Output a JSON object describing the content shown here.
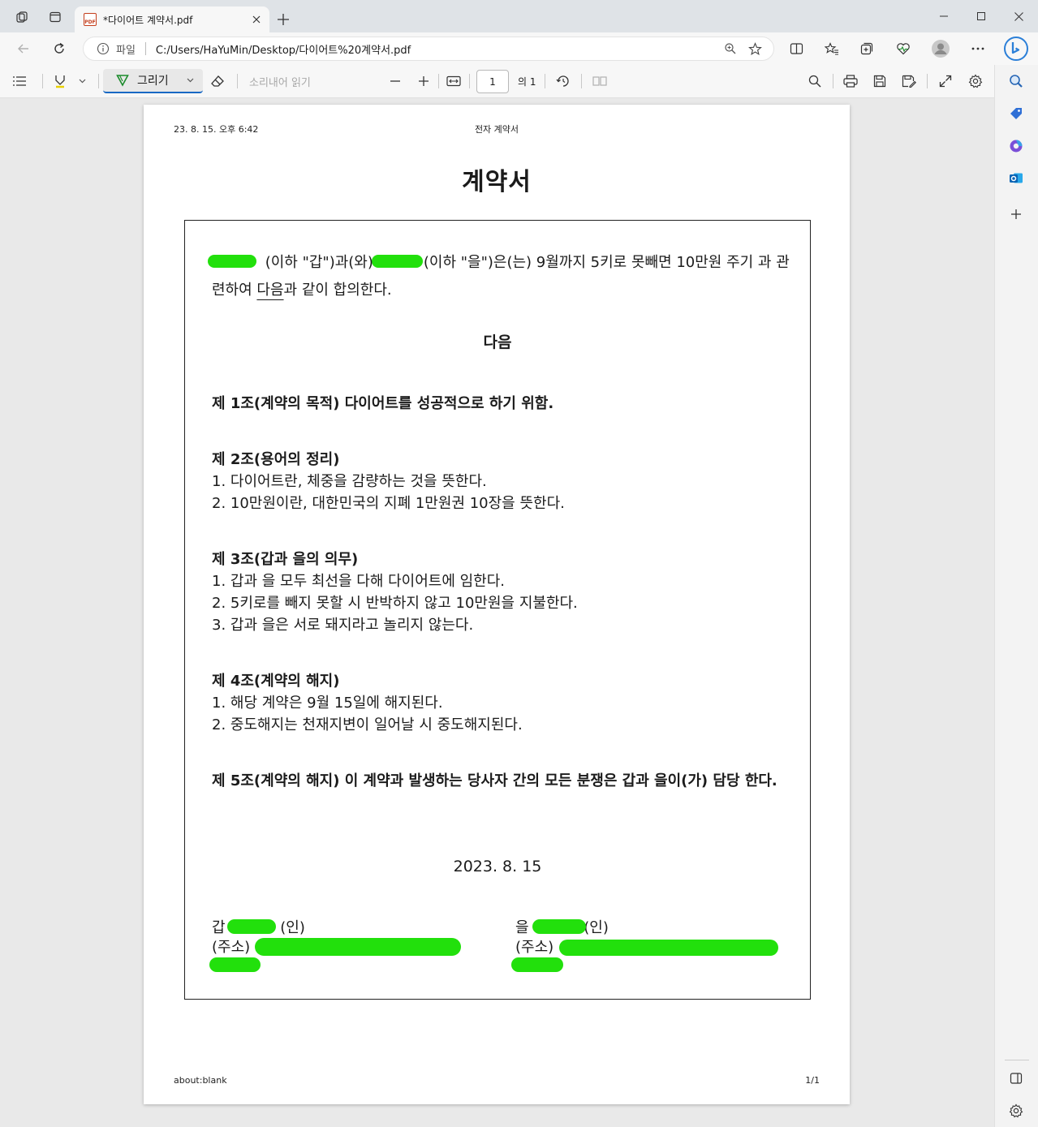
{
  "browser": {
    "tab_title": "*다이어트 계약서.pdf",
    "pdf_badge": "PDF",
    "address": {
      "scheme_label": "파일",
      "url": "C:/Users/HaYuMin/Desktop/다이어트%20계약서.pdf"
    }
  },
  "pdf_toolbar": {
    "draw_label": "그리기",
    "read_aloud_label": "소리내어 읽기",
    "page_number": "1",
    "page_of": "의 1"
  },
  "document": {
    "header_left": "23. 8. 15. 오후 6:42",
    "header_center": "전자 계약서",
    "title": "계약서",
    "intro_part1": " (이하 \"갑\")과(와)",
    "intro_part2": "(이하 \"을\")은(는) 9월까지 5키로 못빼면 10만원 주기 과 관련하여 ",
    "intro_underlined": "다음",
    "intro_part3": "과 같이 합의한다.",
    "section_heading": "다음",
    "articles": [
      {
        "heading": "제 1조(계약의 목적) 다이어트를 성공적으로 하기 위함.",
        "lines": []
      },
      {
        "heading": "제 2조(용어의 정리)",
        "lines": [
          "1. 다이어트란, 체중을 감량하는 것을 뜻한다.",
          "2. 10만원이란, 대한민국의 지폐 1만원권 10장을 뜻한다."
        ]
      },
      {
        "heading": "제 3조(갑과 을의 의무)",
        "lines": [
          "1. 갑과 을 모두 최선을 다해 다이어트에 임한다.",
          "2. 5키로를 빼지 못할 시 반박하지 않고 10만원을 지불한다.",
          "3. 갑과 을은 서로 돼지라고 놀리지 않는다."
        ]
      },
      {
        "heading": "제 4조(계약의 해지)",
        "lines": [
          "1. 해당 계약은 9월 15일에 해지된다.",
          "2. 중도해지는 천재지변이 일어날 시 중도해지된다."
        ]
      },
      {
        "heading": "제 5조(계약의 해지) 이 계약과 발생하는 당사자 간의 모든 분쟁은 갑과 을이(가) 담당 한다.",
        "lines": []
      }
    ],
    "date": "2023. 8. 15",
    "party_a": {
      "label": "갑",
      "seal": " (인)",
      "address_label": "(주소)"
    },
    "party_b": {
      "label": "을",
      "seal": " (인)",
      "address_label": "(주소)"
    },
    "footer_left": "about:blank",
    "footer_right": "1/1"
  },
  "colors": {
    "redaction": "#22e00c",
    "accent": "#1868c4"
  }
}
